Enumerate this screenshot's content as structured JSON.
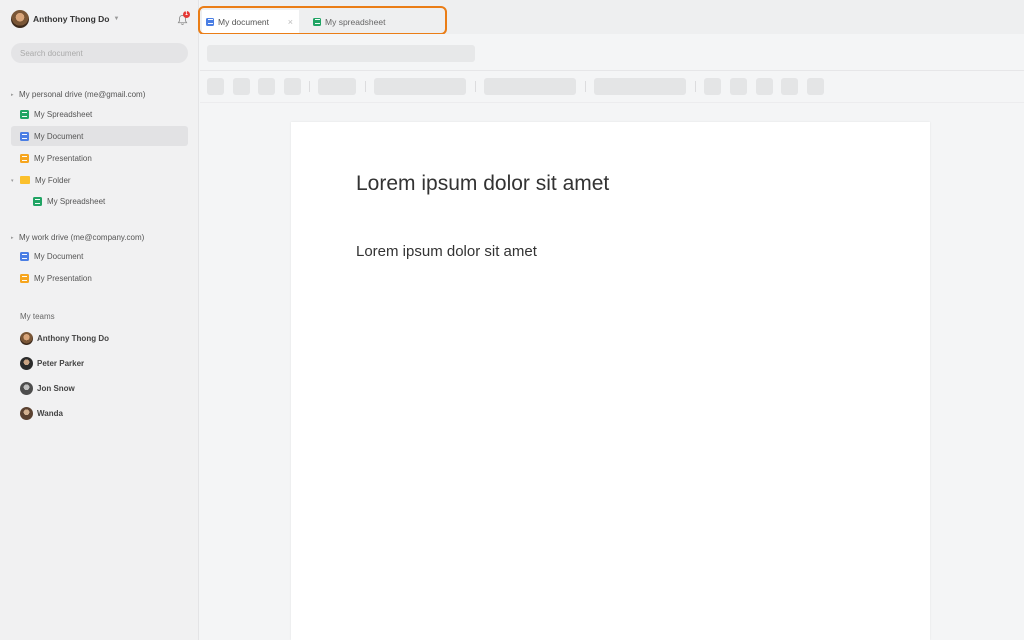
{
  "user": {
    "name": "Anthony Thong Do"
  },
  "notifications": {
    "count": "1"
  },
  "search": {
    "placeholder": "Search document"
  },
  "drives": [
    {
      "label": "My personal drive (me@gmail.com)",
      "items": [
        {
          "label": "My Spreadsheet",
          "icon": "spreadsheet-icon"
        },
        {
          "label": "My Document",
          "icon": "document-icon",
          "active": true
        },
        {
          "label": "My Presentation",
          "icon": "presentation-icon"
        },
        {
          "label": "My Folder",
          "icon": "folder-icon",
          "children": [
            {
              "label": "My Spreadsheet",
              "icon": "spreadsheet-icon"
            }
          ]
        }
      ]
    },
    {
      "label": "My work drive (me@company.com)",
      "items": [
        {
          "label": "My Document",
          "icon": "document-icon"
        },
        {
          "label": "My Presentation",
          "icon": "presentation-icon"
        }
      ]
    }
  ],
  "teams": {
    "title": "My teams",
    "members": [
      {
        "name": "Anthony Thong Do"
      },
      {
        "name": "Peter Parker"
      },
      {
        "name": "Jon Snow"
      },
      {
        "name": "Wanda"
      }
    ]
  },
  "tabs": [
    {
      "label": "My document",
      "icon": "document-icon",
      "active": true
    },
    {
      "label": "My spreadsheet",
      "icon": "spreadsheet-icon",
      "active": false
    }
  ],
  "document": {
    "heading": "Lorem ipsum dolor sit amet",
    "paragraph": "Lorem ipsum dolor sit amet"
  },
  "colors": {
    "accent_highlight": "#ea7d16",
    "spreadsheet": "#20a464",
    "document": "#4a7ee4",
    "presentation": "#f6a51e",
    "folder": "#fbc02d"
  }
}
